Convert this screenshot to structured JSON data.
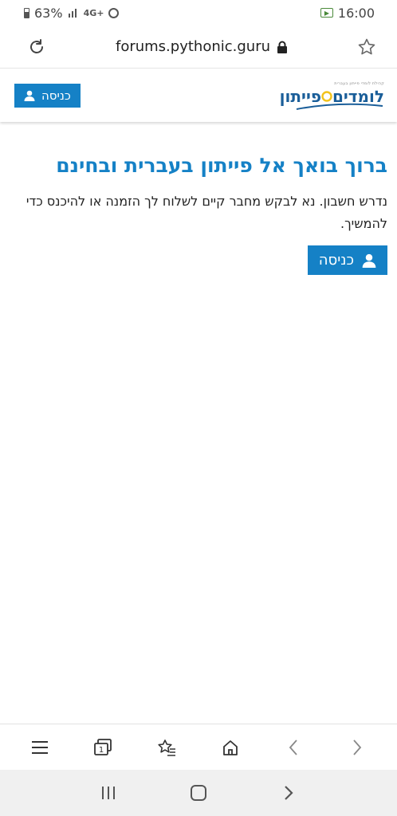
{
  "status_bar": {
    "battery_percent": "63%",
    "network_label": "4G+",
    "time": "16:00",
    "icons": [
      "battery-icon",
      "signal-icon",
      "network-4g-icon",
      "alarm-icon",
      "cast-icon"
    ]
  },
  "browser": {
    "url": "forums.pythonic.guru",
    "icons": [
      "reload-icon",
      "lock-icon",
      "star-icon"
    ]
  },
  "header": {
    "login_label": "כניסה",
    "logo": {
      "tagline": "קהילת לומדי פייתון בעברית",
      "word_a": "לומדים",
      "word_b": "פייתון"
    }
  },
  "main": {
    "title": "ברוך בואך אל פייתון בעברית ובחינם",
    "text": "נדרש חשבון. נא לבקש מחבר קיים לשלוח לך הזמנה או להיכנס כדי להמשיך.",
    "login_label": "כניסה"
  },
  "browser_toolbar": {
    "icons": [
      "menu-icon",
      "tabs-icon",
      "bookmarks-icon",
      "home-icon",
      "back-icon",
      "forward-icon"
    ],
    "tabs_count": "1"
  },
  "nav_bar": {
    "icons": [
      "recent-apps-icon",
      "home-nav-icon",
      "back-nav-icon"
    ]
  },
  "colors": {
    "accent": "#1581c6",
    "logo_blue": "#1a5e99",
    "logo_yellow": "#f2c21b"
  }
}
